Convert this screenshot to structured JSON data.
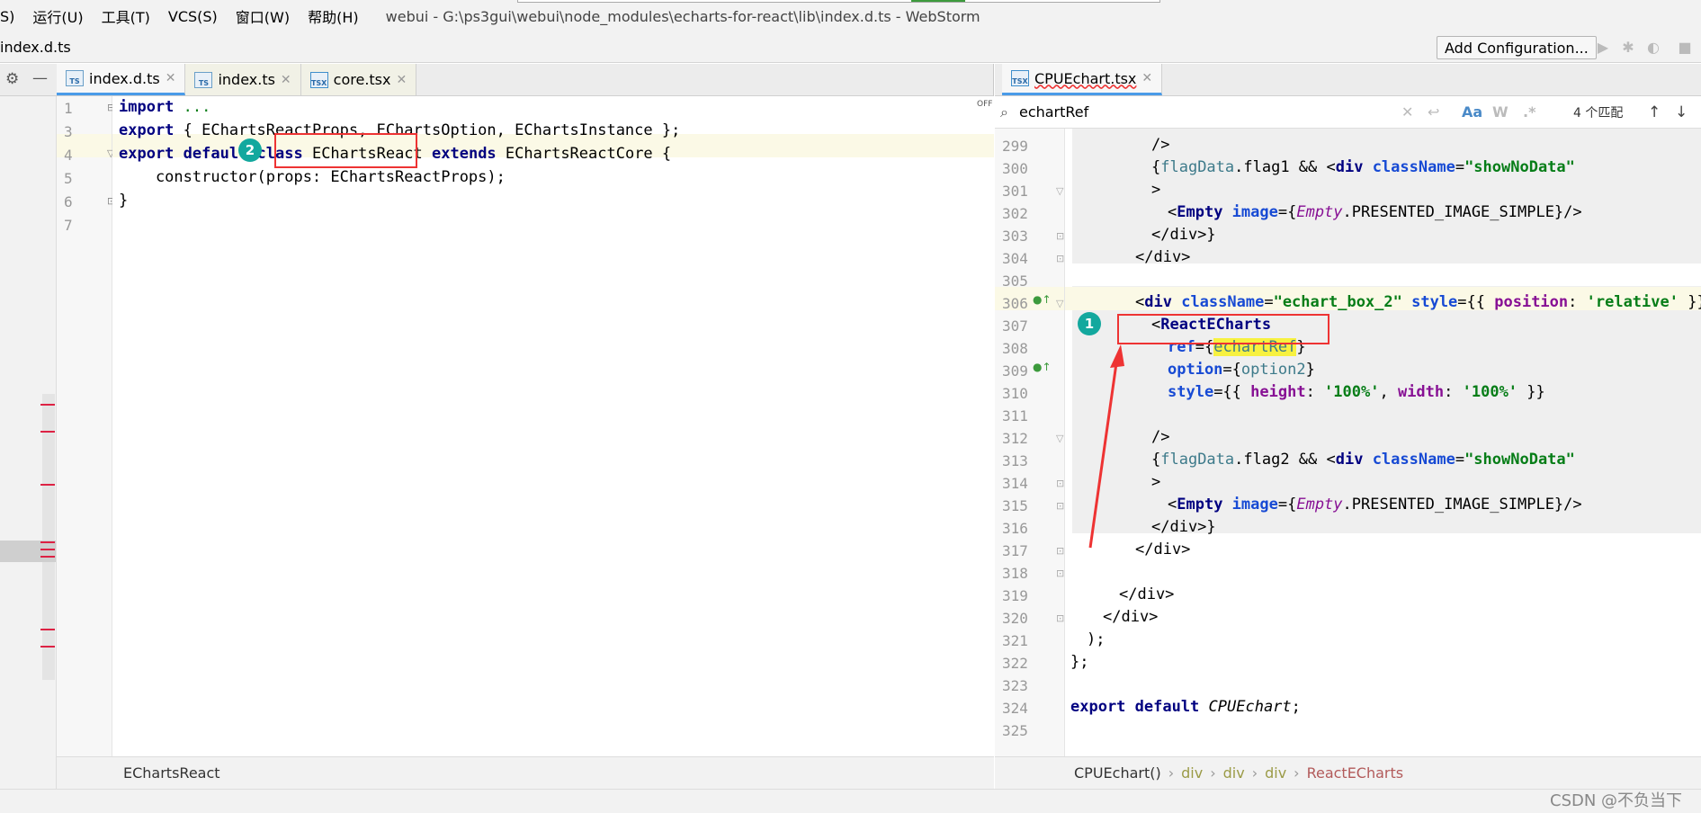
{
  "menu": {
    "items": [
      "S)",
      "运行(U)",
      "工具(T)",
      "VCS(S)",
      "窗口(W)",
      "帮助(H)"
    ],
    "window_title": "webui - G:\\ps3gui\\webui\\node_modules\\echarts-for-react\\lib\\index.d.ts - WebStorm"
  },
  "navbar": {
    "file": "index.d.ts",
    "add_config": "Add Configuration..."
  },
  "left": {
    "tabs": [
      {
        "label": "index.d.ts",
        "icon": "TS"
      },
      {
        "label": "index.ts",
        "icon": "TS"
      },
      {
        "label": "core.tsx",
        "icon": "TSX"
      }
    ],
    "off_label": "OFF",
    "line_numbers": [
      "1",
      "3",
      "4",
      "5",
      "6",
      "7"
    ],
    "lines": {
      "l1a": "import",
      "l1b": " ...",
      "l3a": "export",
      "l3b": " { EChartsReactProps, EChartsOption, EChartsInstance };",
      "l4a": "export default ",
      "l4b": "class",
      "l4c": " EChartsReact ",
      "l4d": "extends",
      "l4e": " EChartsReactCore {",
      "l5": "    constructor(props: EChartsReactProps);",
      "l6": "}"
    },
    "status": "EChartsReact",
    "badge": "2"
  },
  "right": {
    "tab": {
      "label": "CPUEchart.tsx",
      "icon": "TSX"
    },
    "search": {
      "query": "echartRef",
      "aa": "Aa",
      "w": "W",
      "regex": ".*",
      "matches": "4 个匹配"
    },
    "line_numbers": [
      "299",
      "300",
      "301",
      "302",
      "303",
      "304",
      "305",
      "306",
      "307",
      "308",
      "309",
      "310",
      "311",
      "312",
      "313",
      "314",
      "315",
      "316",
      "317",
      "318",
      "319",
      "320",
      "321",
      "322",
      "323",
      "324",
      "325"
    ],
    "code": {
      "c299": "/>",
      "c300a": "{",
      "c300b": "flagData",
      "c300c": ".flag1 && <",
      "c300d": "div",
      "c300e": " className",
      "c300f": "=",
      "c300g": "\"showNoData\"",
      "c301": ">",
      "c302a": "<",
      "c302b": "Empty",
      "c302c": " image",
      "c302d": "={",
      "c302e": "Empty",
      "c302f": ".PRESENTED_IMAGE_SIMPLE}/>",
      "c303": "</div>}",
      "c304": "</div>",
      "c306a": "<",
      "c306b": "div",
      "c306c": " className",
      "c306d": "=",
      "c306e": "\"echart_box_2\"",
      "c306f": " style",
      "c306g": "={{ ",
      "c306h": "position",
      "c306i": ": ",
      "c306j": "'relative'",
      "c306k": " }}>",
      "c307a": "<",
      "c307b": "ReactECharts",
      "c308a": "ref",
      "c308b": "={",
      "c308c": "echartRef",
      "c308d": "}",
      "c309a": "option",
      "c309b": "={",
      "c309c": "option2",
      "c309d": "}",
      "c310a": "style",
      "c310b": "={{ ",
      "c310c": "height",
      "c310d": ": ",
      "c310e": "'100%'",
      "c310f": ", ",
      "c310g": "width",
      "c310h": ": ",
      "c310i": "'100%'",
      "c310j": " }}",
      "c312": "/>",
      "c313a": "{",
      "c313b": "flagData",
      "c313c": ".flag2 && <",
      "c313d": "div",
      "c313e": " className",
      "c313f": "=",
      "c313g": "\"showNoData\"",
      "c314": ">",
      "c315a": "<",
      "c315b": "Empty",
      "c315c": " image",
      "c315d": "={",
      "c315e": "Empty",
      "c315f": ".PRESENTED_IMAGE_SIMPLE}/>",
      "c316": "</div>}",
      "c317": "</div>",
      "c319": "</div>",
      "c320": "</div>",
      "c321": ");",
      "c322": "};",
      "c324a": "export default ",
      "c324b": "CPUEchart",
      "c324c": ";"
    },
    "breadcrumbs": [
      "CPUEchart()",
      "div",
      "div",
      "div",
      "ReactECharts"
    ],
    "badge": "1"
  },
  "watermark": "CSDN @不负当下"
}
